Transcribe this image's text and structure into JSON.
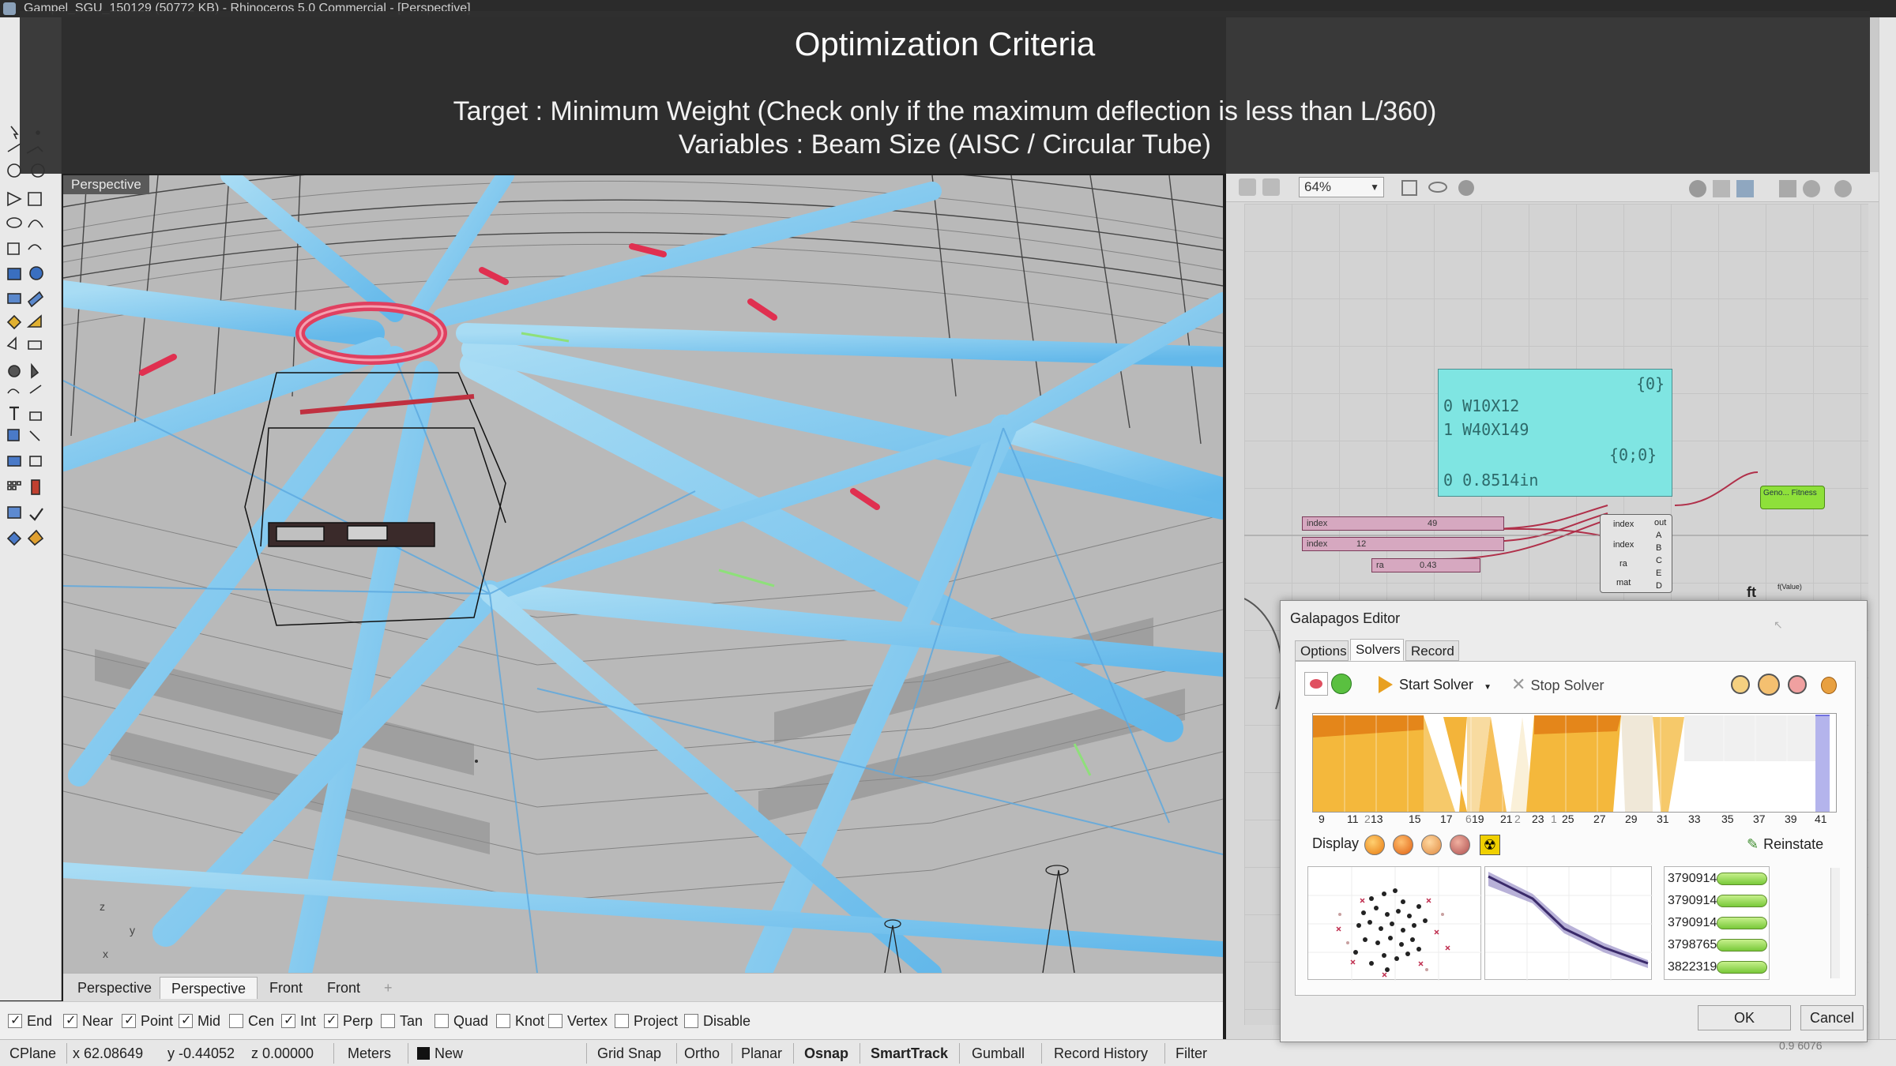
{
  "window": {
    "title": "Gampel_SGU_150129 (50772 KB) - Rhinoceros 5.0 Commercial - [Perspective]"
  },
  "overlay": {
    "title": "Optimization Criteria",
    "target": "Target : Minimum Weight (Check only if the maximum deflection is less than L/360)",
    "variables": "Variables : Beam Size (AISC / Circular Tube)"
  },
  "viewport": {
    "label": "Perspective",
    "axis_z": "z",
    "axis_y": "y",
    "axis_x": "x"
  },
  "viewport_tabs": [
    "Perspective",
    "Perspective",
    "Front",
    "Front"
  ],
  "osnap": [
    {
      "label": "End",
      "checked": true
    },
    {
      "label": "Near",
      "checked": true
    },
    {
      "label": "Point",
      "checked": true
    },
    {
      "label": "Mid",
      "checked": true
    },
    {
      "label": "Cen",
      "checked": false
    },
    {
      "label": "Int",
      "checked": true
    },
    {
      "label": "Perp",
      "checked": true
    },
    {
      "label": "Tan",
      "checked": false
    },
    {
      "label": "Quad",
      "checked": false
    },
    {
      "label": "Knot",
      "checked": false
    },
    {
      "label": "Vertex",
      "checked": false
    },
    {
      "label": "Project",
      "checked": false
    },
    {
      "label": "Disable",
      "checked": false
    }
  ],
  "status": {
    "cplane": "CPlane",
    "x": "x 62.08649",
    "y": "y -0.44052",
    "z": "z 0.00000",
    "units": "Meters",
    "layer": "New",
    "grid_snap": "Grid Snap",
    "ortho": "Ortho",
    "planar": "Planar",
    "osnap": "Osnap",
    "smarttrack": "SmartTrack",
    "gumball": "Gumball",
    "record_history": "Record History",
    "filter": "Filter",
    "right_value": "0.9 6076"
  },
  "grasshopper": {
    "zoom": "64%",
    "panel": {
      "path1": "{0}",
      "row0": "0 W10X12",
      "row1": "1 W40X149",
      "path2": "{0;0}",
      "row2": "0 0.8514in"
    },
    "comp_index": "index",
    "comp_index_val": "49",
    "comp_index2": "index",
    "comp_index2_val": "12",
    "comp_ra": "ra",
    "comp_ra_val": "0.43",
    "cluster_inputs": [
      "index",
      "index",
      "ra",
      "mat"
    ],
    "cluster_outputs": [
      "out",
      "A",
      "B",
      "C",
      "E",
      "D"
    ],
    "geno_label": "Geno... Fitness",
    "ft_label": "ft",
    "ft_value": "f(Value)"
  },
  "galapagos": {
    "title": "Galapagos Editor",
    "tabs": [
      "Options",
      "Solvers",
      "Record"
    ],
    "active_tab": "Solvers",
    "start_solver": "Start Solver",
    "stop_solver": "Stop Solver",
    "display_label": "Display",
    "reinstate": "Reinstate",
    "ok": "OK",
    "cancel": "Cancel",
    "axis_ticks": [
      "9",
      "11",
      "13",
      "15",
      "17",
      "19",
      "21",
      "23",
      "25",
      "27",
      "29",
      "31",
      "33",
      "35",
      "37",
      "39",
      "41"
    ],
    "axis_minor": [
      "2",
      "6",
      "2",
      "1"
    ],
    "genomes": [
      "3790914...",
      "3790914...",
      "3790914...",
      "3798765...",
      "3822319..."
    ],
    "colors": {
      "fitness_fill": "#f2b534",
      "fitness_dark": "#e48a18",
      "highlight": "#7070e0"
    }
  }
}
